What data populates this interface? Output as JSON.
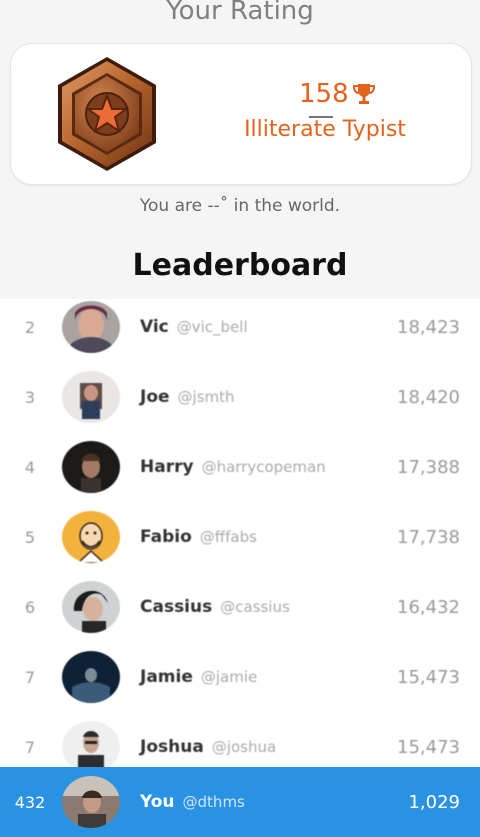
{
  "header": {
    "title": "Your Rating"
  },
  "rating": {
    "score": "158",
    "title": "Illiterate Typist",
    "world_text": "You are --˚ in the world.",
    "badge_icon": "star-badge-icon",
    "trophy_icon": "trophy-icon",
    "accent_color": "#e5621d"
  },
  "leaderboard": {
    "title": "Leaderboard",
    "rows": [
      {
        "rank": "2",
        "name": "Vic",
        "handle": "@vic_bell",
        "points": "18,423",
        "avatar_color": "#8c6a73"
      },
      {
        "rank": "3",
        "name": "Joe",
        "handle": "@jsmth",
        "points": "18,420",
        "avatar_color": "#6d5b52"
      },
      {
        "rank": "4",
        "name": "Harry",
        "handle": "@harrycopeman",
        "points": "17,388",
        "avatar_color": "#2a2726"
      },
      {
        "rank": "5",
        "name": "Fabio",
        "handle": "@fffabs",
        "points": "17,738",
        "avatar_color": "#f3b23b"
      },
      {
        "rank": "6",
        "name": "Cassius",
        "handle": "@cassius",
        "points": "16,432",
        "avatar_color": "#5b5a58"
      },
      {
        "rank": "7",
        "name": "Jamie",
        "handle": "@jamie",
        "points": "15,473",
        "avatar_color": "#1d3a55"
      },
      {
        "rank": "7",
        "name": "Joshua",
        "handle": "@joshua",
        "points": "15,473",
        "avatar_color": "#e8e8e8"
      }
    ],
    "you": {
      "rank": "432",
      "name": "You",
      "handle": "@dthms",
      "points": "1,029",
      "highlight_color": "#2a92e3"
    }
  }
}
